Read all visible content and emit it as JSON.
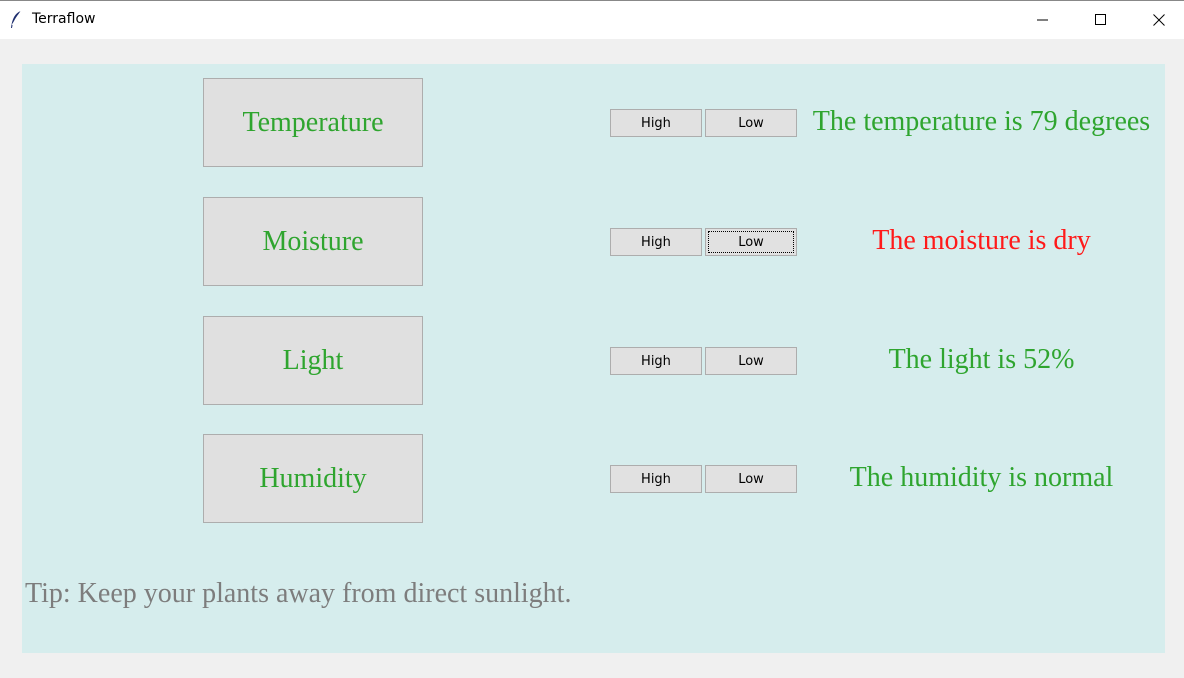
{
  "window": {
    "title": "Terraflow",
    "icon": "feather-icon"
  },
  "rows": [
    {
      "label": "Temperature",
      "high_label": "High",
      "low_label": "Low",
      "status": "The temperature is 79 degrees",
      "status_color": "#2fa52f"
    },
    {
      "label": "Moisture",
      "high_label": "High",
      "low_label": "Low",
      "status": "The moisture is dry",
      "status_color": "#ff1a1a"
    },
    {
      "label": "Light",
      "high_label": "High",
      "low_label": "Low",
      "status": "The light is 52%",
      "status_color": "#2fa52f"
    },
    {
      "label": "Humidity",
      "high_label": "High",
      "low_label": "Low",
      "status": "The humidity is normal",
      "status_color": "#2fa52f"
    }
  ],
  "tip": "Tip: Keep your plants away from direct sunlight.",
  "colors": {
    "panel": "#d6eded",
    "label": "#2fa52f",
    "tip": "#7d7d7d"
  }
}
